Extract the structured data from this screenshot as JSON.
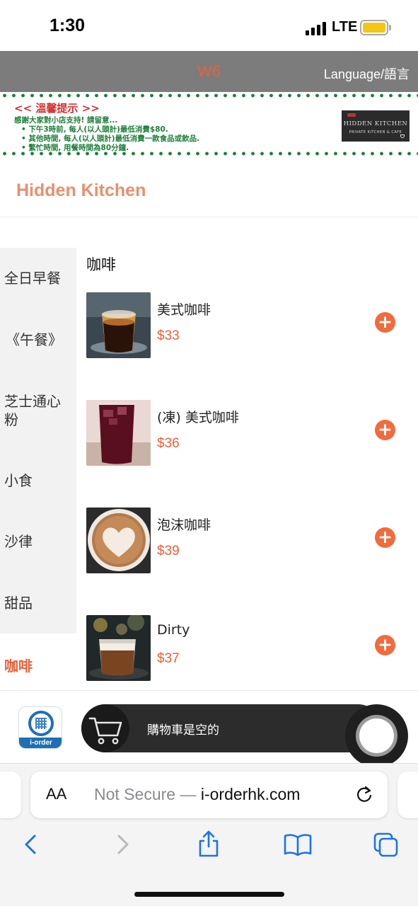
{
  "status_bar": {
    "time": "1:30",
    "network": "LTE",
    "battery_color": "#f3c613"
  },
  "header": {
    "table_id": "W6",
    "language_label": "Language/語言",
    "background_color": "#7c7c7c",
    "accent_color": "#e8613a"
  },
  "notice": {
    "title": "<< 溫馨提示 >>",
    "lines": [
      "感謝大家對小店支持! 請留意...",
      "•    下午3時前, 每人(以人頭計)最低消費$80.",
      "•    其他時間, 每人(以人頭計)最低消費一款食品或飲品.",
      "•    繁忙時間, 用餐時間為80分鐘."
    ],
    "logo_text": "HIDDEN KITCHEN",
    "logo_subtext": "PRIVATE KITCHEN & CAFE"
  },
  "shop": {
    "name": "Hidden Kitchen"
  },
  "categories": {
    "items": [
      "全日早餐",
      "《午餐》",
      "芝士通心粉",
      "小食",
      "沙律",
      "甜品"
    ],
    "active": "咖啡"
  },
  "section": {
    "title": "咖啡"
  },
  "products": [
    {
      "name": "美式咖啡",
      "price": "$33",
      "image": "hot-americano-photo"
    },
    {
      "name": "(凍) 美式咖啡",
      "price": "$36",
      "image": "iced-americano-photo"
    },
    {
      "name": "泡沫咖啡",
      "price": "$39",
      "image": "latte-art-photo"
    },
    {
      "name": "Dirty",
      "price": "$37",
      "image": "dirty-coffee-photo"
    }
  ],
  "add_button_symbol": "+",
  "cart": {
    "empty_text": "購物車是空的",
    "logo_label": "i-order"
  },
  "browser": {
    "text_size_label": "AA",
    "security_text": "Not Secure — ",
    "domain": "i-orderhk.com"
  }
}
